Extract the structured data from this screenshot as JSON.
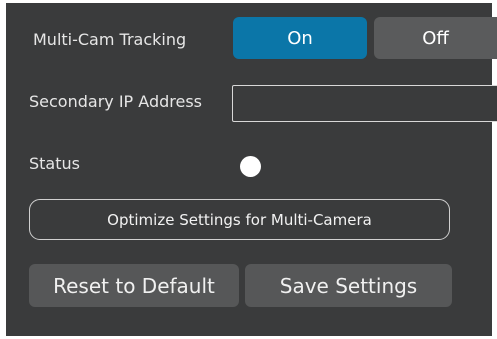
{
  "multi_cam": {
    "label": "Multi-Cam Tracking",
    "on_label": "On",
    "off_label": "Off",
    "selected": "On"
  },
  "secondary_ip": {
    "label": "Secondary IP Address",
    "value": ""
  },
  "status": {
    "label": "Status",
    "indicator_color": "#ffffff"
  },
  "buttons": {
    "optimize": "Optimize Settings for Multi-Camera",
    "reset": "Reset to Default",
    "save": "Save Settings"
  },
  "colors": {
    "panel_bg": "#3a3b3c",
    "accent": "#0b76a8"
  }
}
